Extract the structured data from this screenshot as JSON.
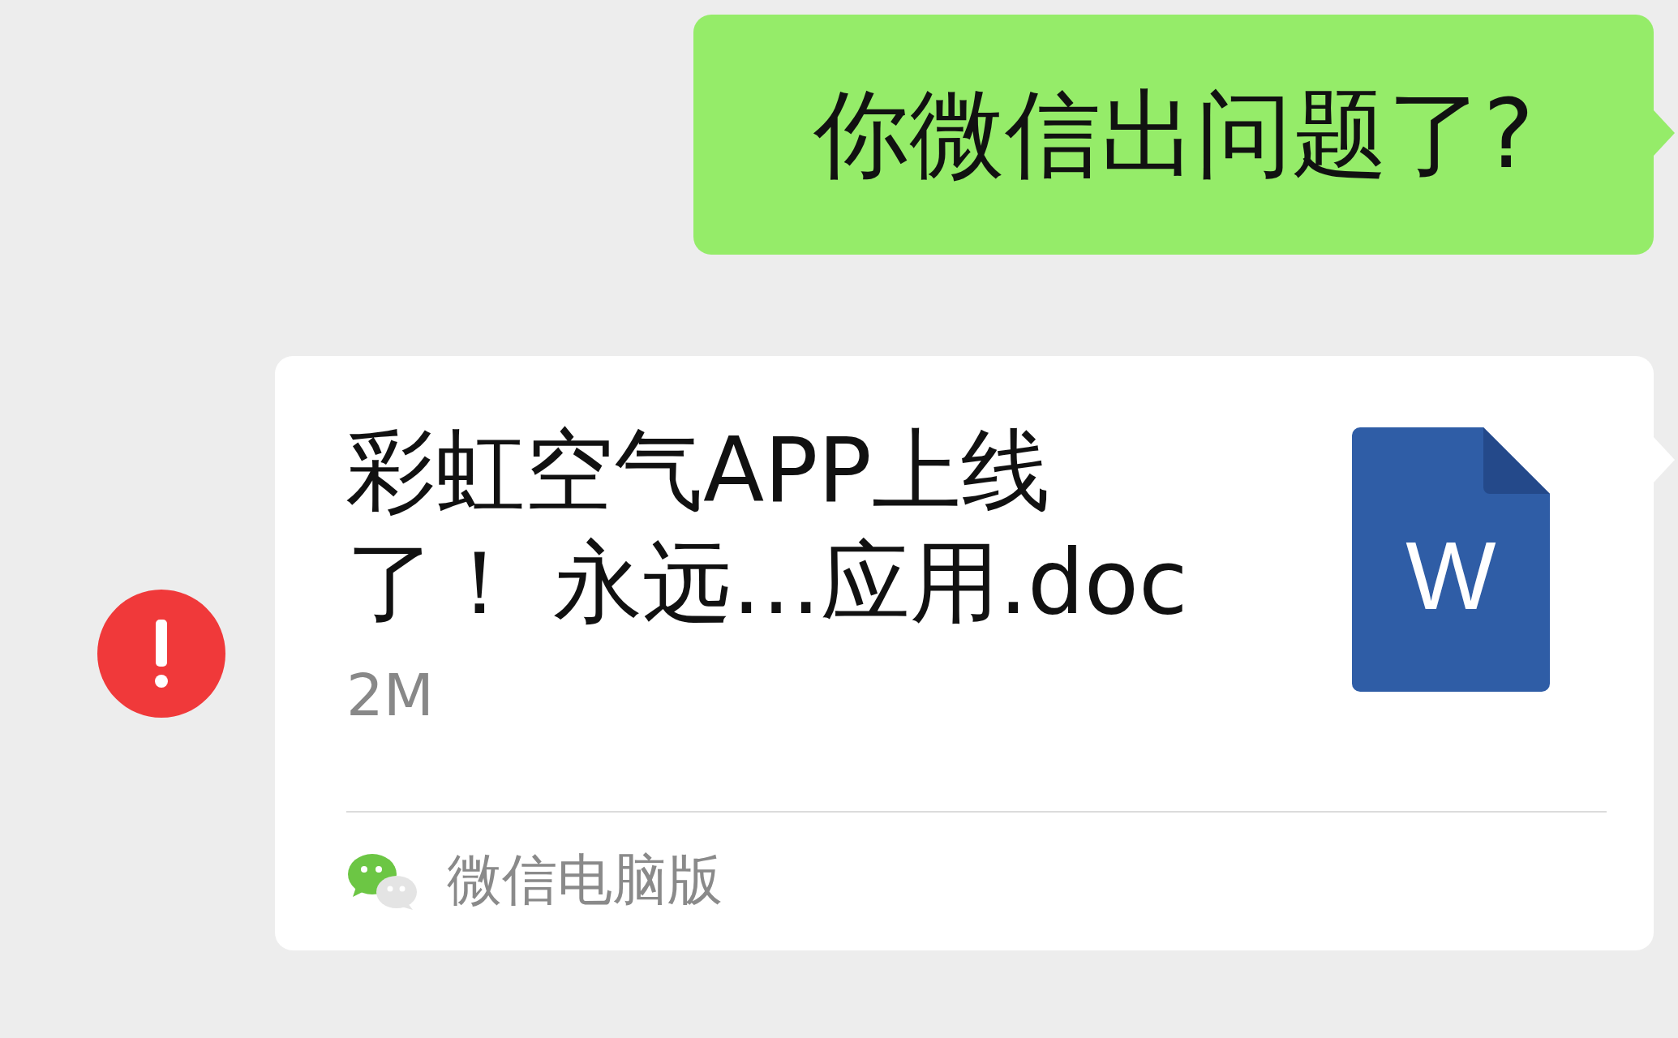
{
  "messages": [
    {
      "kind": "text",
      "text": "你微信出问题了?"
    },
    {
      "kind": "file",
      "failed": true,
      "title_lines": [
        "彩虹空气APP上线",
        "了！ 永远…应用.doc"
      ],
      "size": "2M",
      "file_icon_letter": "W",
      "source": "微信电脑版"
    }
  ]
}
